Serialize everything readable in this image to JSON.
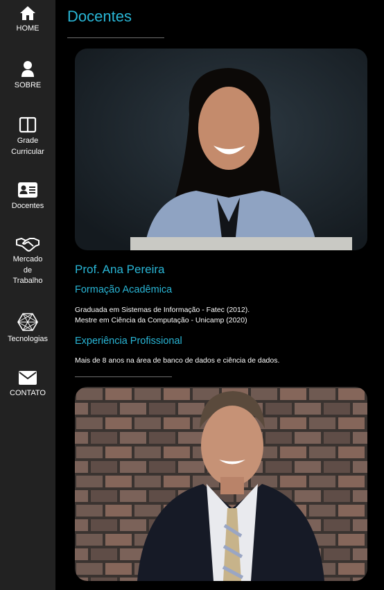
{
  "sidebar": {
    "items": [
      {
        "label": "HOME",
        "icon": "home-icon"
      },
      {
        "label": "SOBRE",
        "icon": "user-icon"
      },
      {
        "label": "Grade\nCurricular",
        "icon": "book-open-icon"
      },
      {
        "label": "Docentes",
        "icon": "id-card-icon"
      },
      {
        "label": "Mercado\nde\nTrabalho",
        "icon": "handshake-icon"
      },
      {
        "label": "Tecnologias",
        "icon": "polygon-mesh-icon"
      },
      {
        "label": "CONTATO",
        "icon": "envelope-icon"
      }
    ]
  },
  "main": {
    "title": "Docentes",
    "teachers": [
      {
        "name": "Prof. Ana Pereira",
        "education_heading": "Formação Acadêmica",
        "education": [
          "Graduada em Sistemas de Informação - Fatec (2012).",
          "Mestre em Ciência da Computação - Unicamp (2020)"
        ],
        "experience_heading": "Experiência Profissional",
        "experience": "Mais de 8 anos na área de banco de dados e ciência de dados."
      },
      {
        "name": "",
        "education_heading": "",
        "education": [],
        "experience_heading": "",
        "experience": ""
      }
    ]
  },
  "colors": {
    "accent": "#29b6d6",
    "sidebar_bg": "#222222",
    "page_bg": "#000000"
  }
}
